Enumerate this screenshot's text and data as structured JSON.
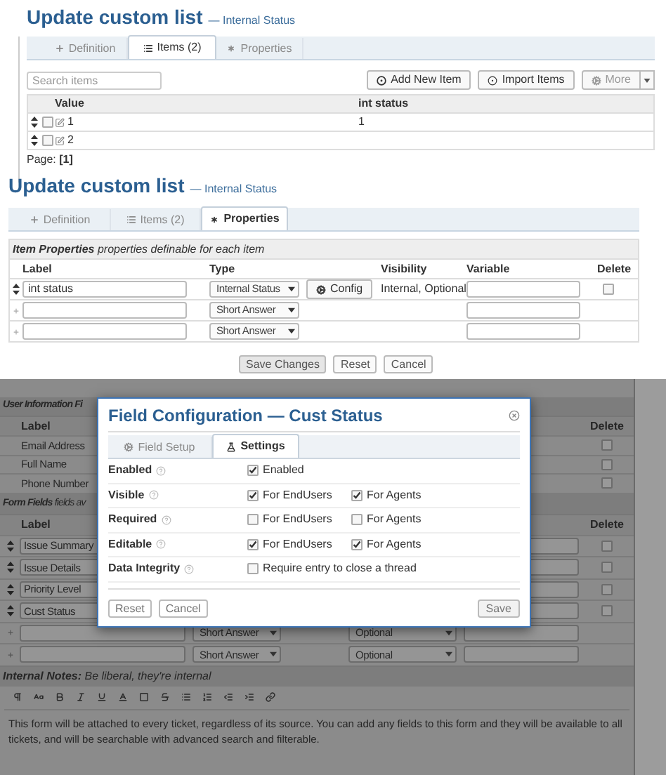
{
  "items_panel": {
    "title": "Update custom list",
    "subtitle": "— Internal Status",
    "tabs": [
      {
        "label": "Definition",
        "selected": false
      },
      {
        "label": "Items (2)",
        "selected": true
      },
      {
        "label": "Properties",
        "selected": false
      }
    ],
    "search": {
      "placeholder": "Search items"
    },
    "actions": [
      "Add New Item",
      "Import Items",
      "More"
    ],
    "columns": [
      "Value",
      "int status"
    ],
    "rows": [
      {
        "value": "1",
        "int_status": "1",
        "checked": false
      },
      {
        "value": "2",
        "checked": false
      }
    ],
    "pager": "Page: **[1]**"
  },
  "properties_panel": {
    "title": "Update custom list",
    "subtitle": "— Internal Status",
    "tabs": [
      {
        "label": "Definition",
        "selected": false
      },
      {
        "label": "Items (2)",
        "selected": false
      },
      {
        "label": "Properties",
        "selected": true
      }
    ],
    "section_title": "**Item Properties** properties definable for each item",
    "columns": [
      "Label",
      "Type",
      "Visibility",
      "Variable",
      "Delete"
    ],
    "rows": [
      {
        "kind": "existing",
        "label": "int status",
        "type": "Internal Status",
        "config": "Config",
        "visibility": "Internal, Optional",
        "delete_checked": false
      },
      {
        "kind": "new",
        "type": "Short Answer"
      },
      {
        "kind": "new",
        "type": "Short Answer"
      }
    ],
    "buttons": [
      "Save Changes",
      "Reset",
      "Cancel"
    ]
  },
  "form_panel": {
    "user_section_title": "User Information Fi",
    "user_columns": [
      "Label",
      "Delete"
    ],
    "user_fields": [
      {
        "label": "Email Address",
        "delete_checked": false
      },
      {
        "label": "Full Name",
        "delete_checked": false
      },
      {
        "label": "Phone Number",
        "delete_checked": false
      }
    ],
    "form_section_title": "**Form Fields** fields av",
    "form_columns": [
      "Label",
      "Delete"
    ],
    "form_fields": [
      {
        "kind": "existing",
        "label": "Issue Summary",
        "delete_checked": false
      },
      {
        "kind": "existing",
        "label": "Issue Details",
        "delete_checked": false
      },
      {
        "kind": "existing",
        "label": "Priority Level",
        "delete_checked": false
      },
      {
        "kind": "existing",
        "label": "Cust Status",
        "delete_checked": false
      },
      {
        "kind": "new",
        "type": "Short Answer",
        "requirement": "Optional"
      },
      {
        "kind": "new",
        "type": "Short Answer",
        "requirement": "Optional"
      }
    ],
    "notes_title": "**Internal Notes:** Be liberal, they're internal",
    "notes_text": "This form will be attached to every ticket, regardless of its source. You can add any fields to this form and they will be available to all tickets, and will be searchable with advanced search and filterable."
  },
  "dialog": {
    "title": "Field Configuration — Cust Status",
    "tabs": [
      {
        "label": "Field Setup",
        "selected": false
      },
      {
        "label": "Settings",
        "selected": true
      }
    ],
    "settings": [
      {
        "label": "Enabled",
        "options": [
          {
            "label": "Enabled",
            "checked": true
          }
        ]
      },
      {
        "label": "Visible",
        "options": [
          {
            "label": "For EndUsers",
            "checked": true
          },
          {
            "label": "For Agents",
            "checked": true
          }
        ]
      },
      {
        "label": "Required",
        "options": [
          {
            "label": "For EndUsers",
            "checked": false
          },
          {
            "label": "For Agents",
            "checked": false
          }
        ]
      },
      {
        "label": "Editable",
        "options": [
          {
            "label": "For EndUsers",
            "checked": true
          },
          {
            "label": "For Agents",
            "checked": true
          }
        ]
      },
      {
        "label": "Data Integrity",
        "options": [
          {
            "label": "Require entry to close a thread",
            "checked": false
          }
        ]
      }
    ],
    "buttons_left": [
      "Reset",
      "Cancel"
    ],
    "button_right": "Save"
  }
}
